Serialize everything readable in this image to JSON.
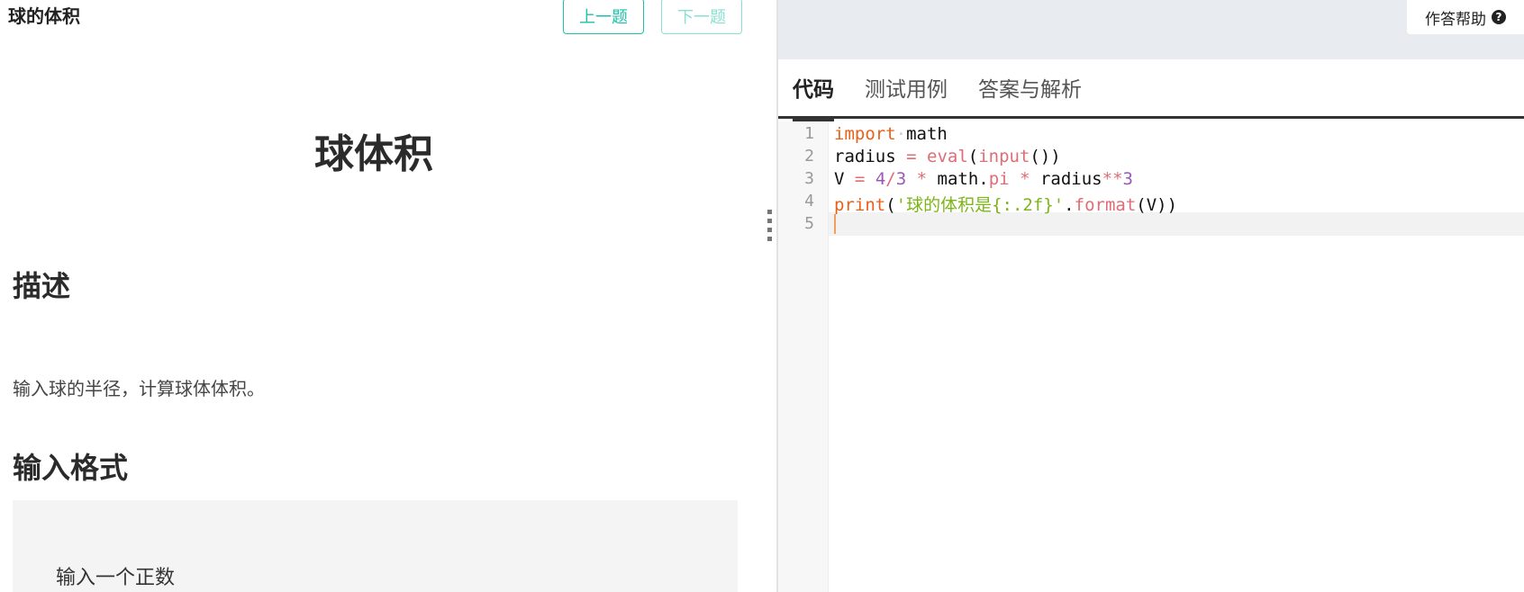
{
  "left": {
    "small_title": "球的体积",
    "prev_label": "上一题",
    "next_label": "下一题",
    "heading": "球体积",
    "desc_heading": "描述",
    "desc_text": "输入球的半径，计算球体体积。",
    "input_heading": "输入格式",
    "input_text": "输入一个正数"
  },
  "right": {
    "help_label": "作答帮助",
    "help_icon": "?",
    "tabs": [
      {
        "label": "代码"
      },
      {
        "label": "测试用例"
      },
      {
        "label": "答案与解析"
      }
    ]
  },
  "editor": {
    "line_numbers": [
      "1",
      "2",
      "3",
      "4",
      "5"
    ],
    "lines": [
      "import math",
      "radius = eval(input())",
      "V = 4/3 * math.pi * radius**3",
      "print('球的体积是{:.2f}'.format(V))",
      ""
    ],
    "tokens": {
      "l1_kw": "import",
      "l1_rest": "math",
      "l2_a": "radius",
      "l2_op": "=",
      "l2_fn": "eval",
      "l2_p1": "(",
      "l2_fn2": "input",
      "l2_p2": "())",
      "l3_a": "V",
      "l3_op": "=",
      "l3_n1": "4",
      "l3_div": "/",
      "l3_n2": "3",
      "l3_mul": "*",
      "l3_math": "math.",
      "l3_pi": "pi",
      "l3_mul2": "*",
      "l3_rad": "radius",
      "l3_pow": "**",
      "l3_n3": "3",
      "l4_kw": "print",
      "l4_p": "(",
      "l4_str": "'球的体积是{:.2f}'",
      "l4_dot": ".",
      "l4_fn": "format",
      "l4_end": "(V))"
    }
  }
}
